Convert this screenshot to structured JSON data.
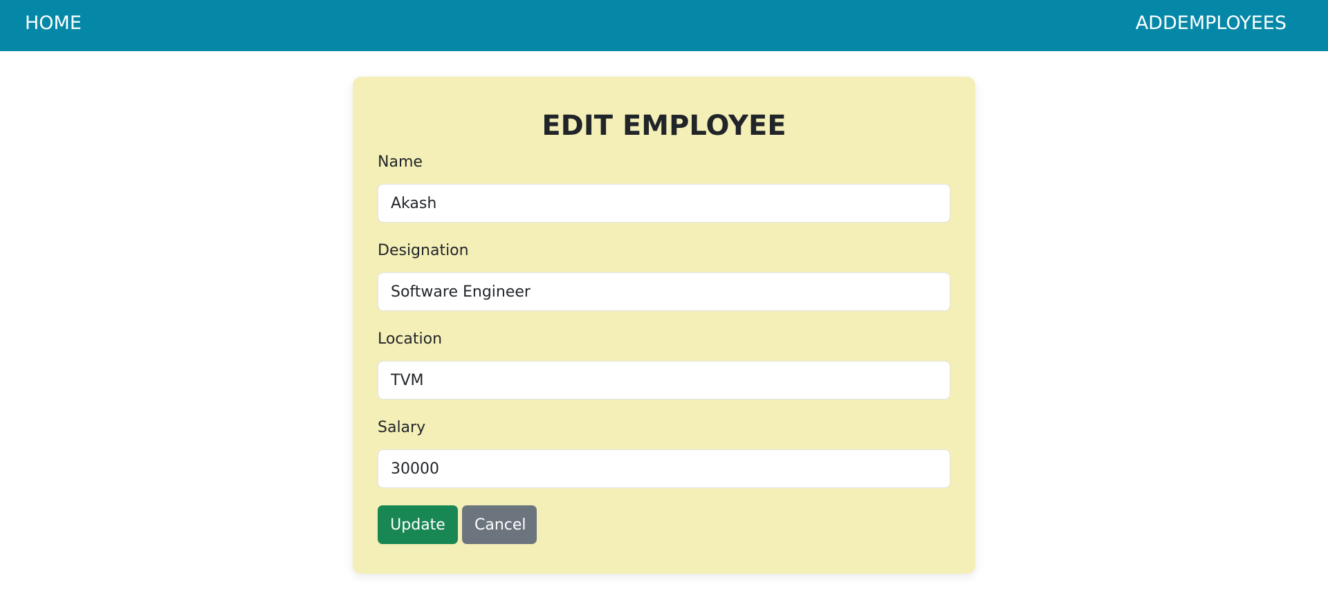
{
  "nav": {
    "home_label": "HOME",
    "add_label": "ADDEMPLOYEES"
  },
  "form": {
    "title": "EDIT EMPLOYEE",
    "fields": [
      {
        "label": "Name",
        "value": "Akash"
      },
      {
        "label": "Designation",
        "value": "Software Engineer"
      },
      {
        "label": "Location",
        "value": "TVM"
      },
      {
        "label": "Salary",
        "value": "30000"
      }
    ],
    "update_label": "Update",
    "cancel_label": "Cancel"
  },
  "colors": {
    "navbar": "#0588a8",
    "card": "#f4efb7",
    "update_button": "#198754",
    "cancel_button": "#6c757d"
  }
}
